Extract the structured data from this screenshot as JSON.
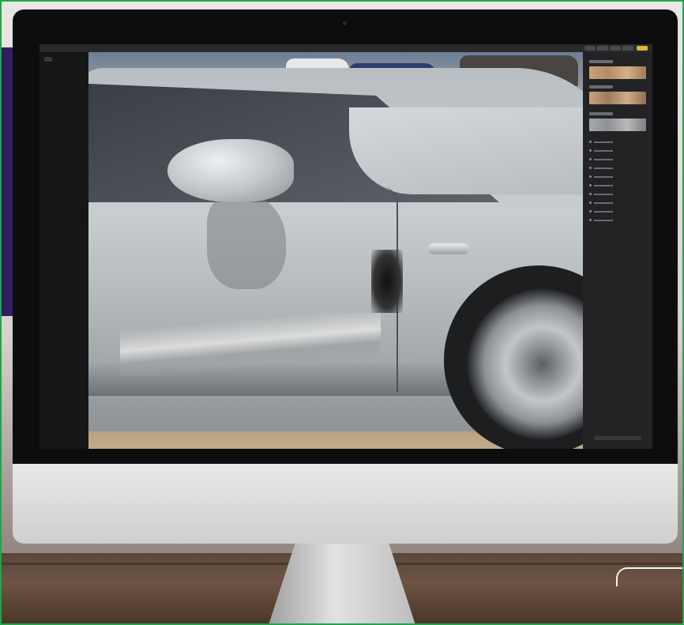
{
  "scene": {
    "subject": "",
    "photo_content": "",
    "colors": {
      "frame_border": "#1fa64a",
      "bezel": "#0d0d0f",
      "chin": "#d9d9d9",
      "desk": "#5b4638"
    }
  },
  "app": {
    "toolbar": {
      "buttons": [
        "view-icon",
        "crop-icon",
        "adjust-icon",
        "filter-icon",
        "retouch-icon",
        "done-button"
      ]
    },
    "sidebar": {
      "sections": [
        {
          "icon": "light-icon"
        },
        {
          "icon": "color-icon"
        },
        {
          "icon": "black-white-icon"
        }
      ],
      "adjustment_rows": 10
    }
  }
}
